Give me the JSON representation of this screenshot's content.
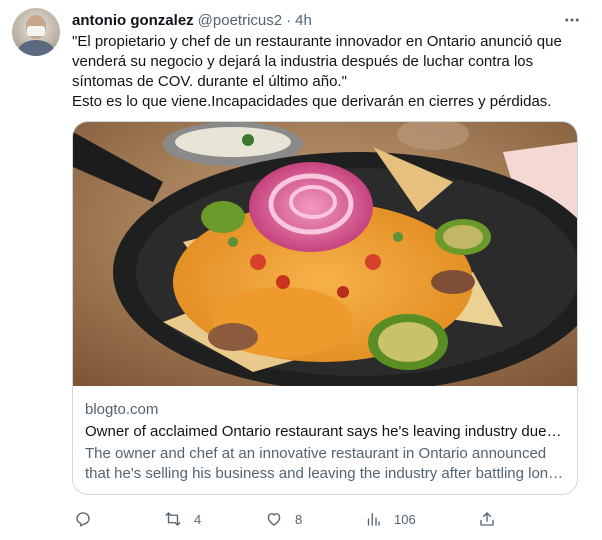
{
  "tweet": {
    "author_name": "antonio gonzalez",
    "handle": "@poetricus2",
    "separator": "·",
    "time": "4h",
    "text_lines": [
      "\"El propietario y chef de un restaurante innovador en Ontario anunció que",
      "venderá su negocio y dejará la industria después de luchar contra los",
      "síntomas de COV. durante el último año.\"",
      "Esto es lo que viene.Incapacidades que derivarán en cierres y pérdidas."
    ]
  },
  "card": {
    "domain": "blogto.com",
    "title": "Owner of acclaimed Ontario restaurant says he's leaving industry due to long COVID",
    "description_lines": [
      "The owner and chef at an innovative restaurant in Ontario announced",
      "that he's selling his business and leaving the industry after battling long COVID symptoms"
    ]
  },
  "actions": {
    "reply_count": "",
    "retweet_count": "4",
    "like_count": "8",
    "views_count": "106"
  },
  "icons": {
    "more": "more-horizontal-icon",
    "reply": "reply-icon",
    "retweet": "retweet-icon",
    "like": "heart-icon",
    "views": "analytics-icon",
    "share": "share-icon"
  },
  "colors": {
    "text_primary": "#0f1419",
    "text_secondary": "#536471",
    "border": "#cfd9de"
  }
}
